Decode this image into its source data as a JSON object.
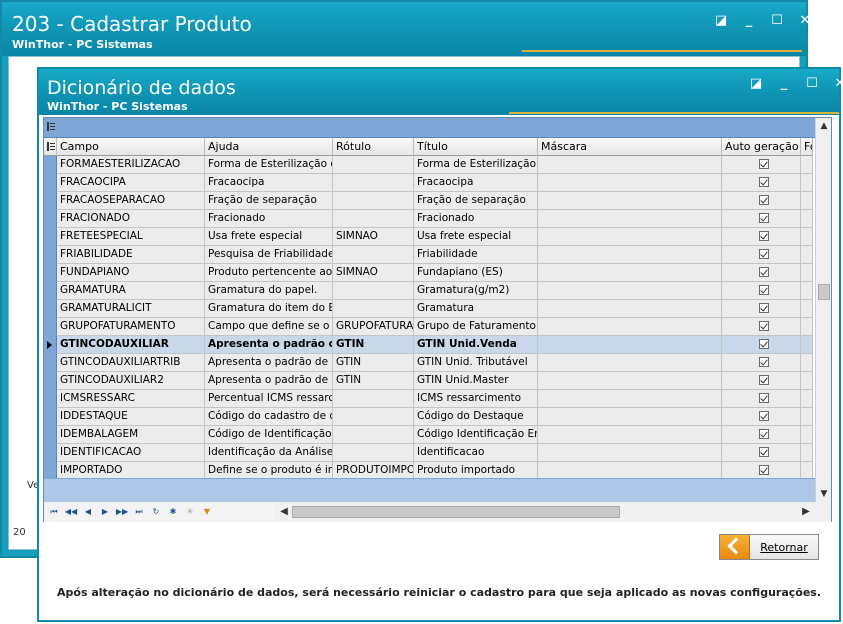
{
  "back_window": {
    "title": "203 - Cadastrar  Produto",
    "subtitle": "WinThor - PC Sistemas",
    "frag1": "Ve",
    "frag2": "20"
  },
  "front_window": {
    "title": "Dicionário de dados",
    "subtitle": "WinThor - PC Sistemas"
  },
  "grid": {
    "columns": [
      "Campo",
      "Ajuda",
      "Rótulo",
      "Título",
      "Máscara",
      "Auto geração",
      "Fó"
    ],
    "rows": [
      {
        "campo": "FORMAESTERILIZACAO",
        "ajuda": "Forma de Esterilização do",
        "rotulo": "",
        "titulo": "Forma de Esterilização",
        "mascara": "",
        "auto": true
      },
      {
        "campo": "FRACAOCIPA",
        "ajuda": "Fracaocipa",
        "rotulo": "",
        "titulo": "Fracaocipa",
        "mascara": "",
        "auto": true
      },
      {
        "campo": "FRACAOSEPARACAO",
        "ajuda": "Fração de separação",
        "rotulo": "",
        "titulo": "Fração de separação",
        "mascara": "",
        "auto": true
      },
      {
        "campo": "FRACIONADO",
        "ajuda": "Fracionado",
        "rotulo": "",
        "titulo": "Fracionado",
        "mascara": "",
        "auto": true
      },
      {
        "campo": "FRETEESPECIAL",
        "ajuda": "Usa frete especial",
        "rotulo": "SIMNAO",
        "titulo": "Usa frete especial",
        "mascara": "",
        "auto": true
      },
      {
        "campo": "FRIABILIDADE",
        "ajuda": "Pesquisa de Friabilidade.",
        "rotulo": "",
        "titulo": "Friabilidade",
        "mascara": "",
        "auto": true
      },
      {
        "campo": "FUNDAPIANO",
        "ajuda": "Produto pertencente ao F",
        "rotulo": "SIMNAO",
        "titulo": "Fundapiano (ES)",
        "mascara": "",
        "auto": true
      },
      {
        "campo": "GRAMATURA",
        "ajuda": "Gramatura do papel.",
        "rotulo": "",
        "titulo": "Gramatura(g/m2)",
        "mascara": "",
        "auto": true
      },
      {
        "campo": "GRAMATURALICIT",
        "ajuda": "Gramatura do item do Edit",
        "rotulo": "",
        "titulo": "Gramatura",
        "mascara": "",
        "auto": true
      },
      {
        "campo": "GRUPOFATURAMENTO",
        "ajuda": "Campo que define se o gr",
        "rotulo": "GRUPOFATURAI",
        "titulo": "Grupo de Faturamento",
        "mascara": "",
        "auto": true
      },
      {
        "campo": "GTINCODAUXILIAR",
        "ajuda": "Apresenta o padrão de",
        "rotulo": "GTIN",
        "titulo": "GTIN Unid.Venda",
        "mascara": "",
        "auto": true,
        "selected": true
      },
      {
        "campo": "GTINCODAUXILIARTRIB",
        "ajuda": "Apresenta o padrão de có",
        "rotulo": "GTIN",
        "titulo": "GTIN Unid. Tributável",
        "mascara": "",
        "auto": true
      },
      {
        "campo": "GTINCODAUXILIAR2",
        "ajuda": "Apresenta o padrão de có",
        "rotulo": "GTIN",
        "titulo": "GTIN Unid.Master",
        "mascara": "",
        "auto": true
      },
      {
        "campo": "ICMSRESSARC",
        "ajuda": "Percentual ICMS ressarcin",
        "rotulo": "",
        "titulo": "ICMS ressarcimento",
        "mascara": "",
        "auto": true
      },
      {
        "campo": "IDDESTAQUE",
        "ajuda": "Código do cadastro de de",
        "rotulo": "",
        "titulo": "Código do Destaque",
        "mascara": "",
        "auto": true
      },
      {
        "campo": "IDEMBALAGEM",
        "ajuda": "Código de Identificação d",
        "rotulo": "",
        "titulo": "Código Identificação Emb",
        "mascara": "",
        "auto": true
      },
      {
        "campo": "IDENTIFICACAO",
        "ajuda": "Identificação da Análise.",
        "rotulo": "",
        "titulo": "Identificacao",
        "mascara": "",
        "auto": true
      },
      {
        "campo": "IMPORTADO",
        "ajuda": "Define se o produto é imp",
        "rotulo": "PRODUTOIMPOI",
        "titulo": "Produto importado",
        "mascara": "",
        "auto": true
      }
    ]
  },
  "buttons": {
    "retornar": "Retornar"
  },
  "footer_note": "Após alteração no dicionário de dados, será necessário reiniciar o cadastro para que seja aplicado as novas configurações.",
  "colors": {
    "titlebar": "#0e93b3",
    "accent_gold": "#d8b43a",
    "grid_band": "#7ea7d8",
    "selected_row": "#c8d7ea"
  }
}
